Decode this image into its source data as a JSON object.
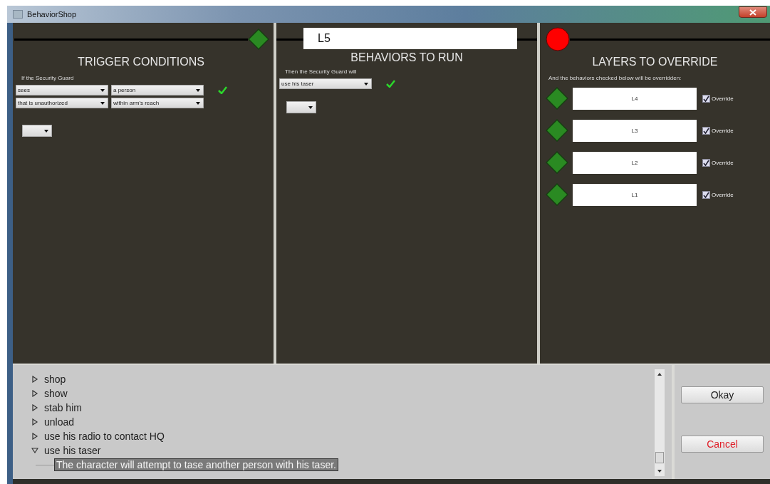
{
  "window": {
    "title": "BehaviorShop"
  },
  "triggers": {
    "heading": "TRIGGER CONDITIONS",
    "intro": "If the Security Guard",
    "rows": [
      {
        "subject": "sees",
        "object": "a person",
        "confirmed": true
      },
      {
        "subject": "that is unauthorized",
        "object": "within arm's reach",
        "confirmed": false
      }
    ]
  },
  "behaviors": {
    "layer": "L5",
    "heading": "BEHAVIORS TO RUN",
    "intro": "Then the Security Guard will",
    "rows": [
      {
        "action": "use his taser",
        "confirmed": true
      }
    ]
  },
  "layers": {
    "heading": "LAYERS TO OVERRIDE",
    "intro": "And the behaviors checked below will be overridden:",
    "items": [
      {
        "name": "L4",
        "checked": true,
        "label": "Override"
      },
      {
        "name": "L3",
        "checked": true,
        "label": "Override"
      },
      {
        "name": "L2",
        "checked": true,
        "label": "Override"
      },
      {
        "name": "L1",
        "checked": true,
        "label": "Override"
      }
    ]
  },
  "tree": [
    {
      "label": "shop",
      "expanded": false
    },
    {
      "label": "show",
      "expanded": false
    },
    {
      "label": "stab him",
      "expanded": false
    },
    {
      "label": "unload",
      "expanded": false
    },
    {
      "label": "use his radio to contact HQ",
      "expanded": false
    },
    {
      "label": "use his taser",
      "expanded": true,
      "children": [
        {
          "label": "The character will attempt to tase another person with his taser.",
          "selected": true
        }
      ]
    }
  ],
  "buttons": [
    {
      "label": "Okay",
      "kind": "primary"
    },
    {
      "label": "Cancel",
      "kind": "cancel"
    }
  ]
}
